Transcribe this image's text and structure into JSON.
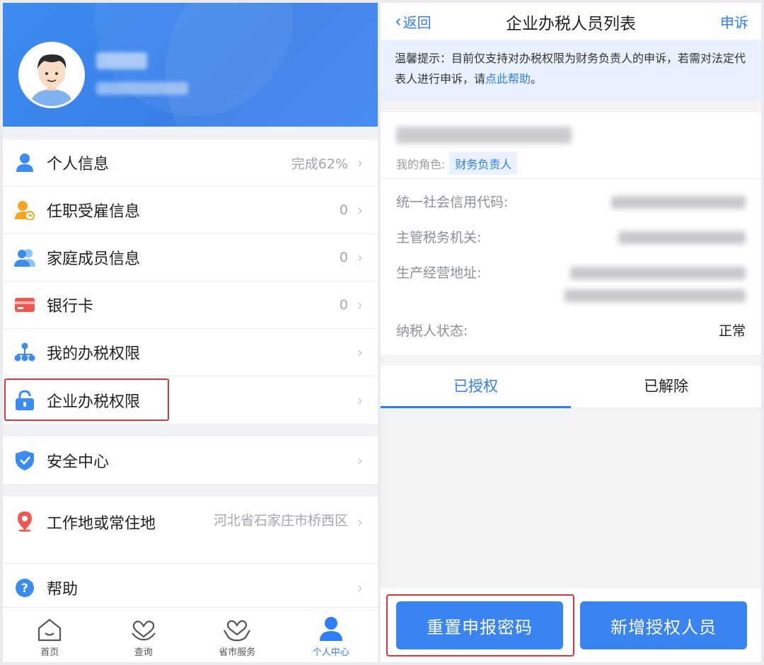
{
  "left": {
    "menu_group1": [
      {
        "label": "个人信息",
        "value": "完成62%",
        "icon": "person-icon"
      },
      {
        "label": "任职受雇信息",
        "value": "0",
        "icon": "employment-icon"
      },
      {
        "label": "家庭成员信息",
        "value": "0",
        "icon": "family-icon"
      },
      {
        "label": "银行卡",
        "value": "0",
        "icon": "bank-card-icon"
      },
      {
        "label": "我的办税权限",
        "value": "",
        "icon": "org-icon"
      },
      {
        "label": "企业办税权限",
        "value": "",
        "icon": "lock-icon"
      }
    ],
    "security": {
      "label": "安全中心",
      "icon": "shield-icon"
    },
    "residence": {
      "label": "工作地或常住地",
      "value": "河北省石家庄市桥西区",
      "icon": "location-icon"
    },
    "help": {
      "label": "帮助",
      "icon": "help-icon"
    },
    "tabbar": [
      {
        "label": "首页",
        "icon": "home-icon"
      },
      {
        "label": "查询",
        "icon": "heart-icon"
      },
      {
        "label": "省市服务",
        "icon": "heart-hands-icon"
      },
      {
        "label": "个人中心",
        "icon": "person-center-icon",
        "active": true
      }
    ]
  },
  "right": {
    "nav": {
      "back_label": "返回",
      "title": "企业办税人员列表",
      "appeal_label": "申诉"
    },
    "tip": {
      "text_before": "温馨提示：目前仅支持对办税权限为财务负责人的申诉，若需对法定代表人进行申诉，请",
      "link": "点此帮助",
      "text_after": "。"
    },
    "role_label": "我的角色:",
    "role_value": "财务负责人",
    "info": {
      "credit_code_label": "统一社会信用代码:",
      "authority_label": "主管税务机关:",
      "address_label": "生产经营地址:",
      "status_label": "纳税人状态:",
      "status_value": "正常"
    },
    "tabs": [
      "已授权",
      "已解除"
    ],
    "buttons": {
      "reset": "重置申报密码",
      "add": "新增授权人员"
    }
  },
  "colors": {
    "accent": "#2f7ef5",
    "highlight": "#e0333a",
    "header": "#3a84f2"
  }
}
